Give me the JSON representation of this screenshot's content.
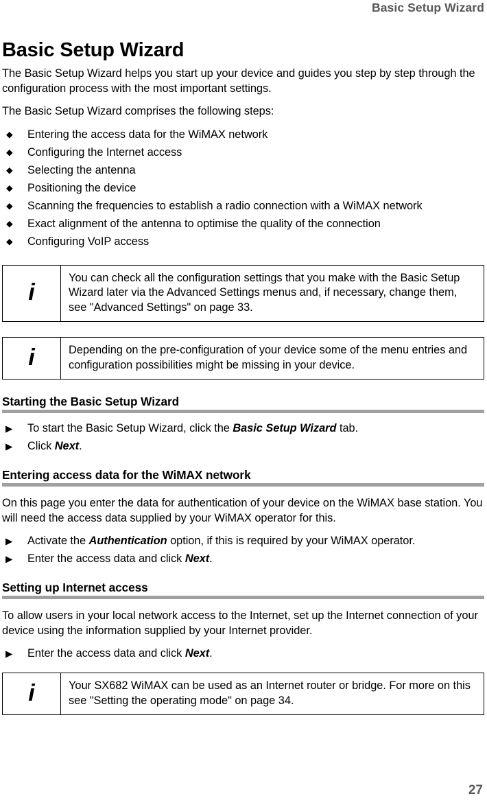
{
  "header": {
    "running_title": "Basic Setup Wizard"
  },
  "page": {
    "title": "Basic Setup Wizard",
    "number": "27"
  },
  "intro": {
    "paragraph_1": "The Basic Setup Wizard helps you start up your device and guides you step by step through the configuration process with the most important settings.",
    "paragraph_2": "The Basic Setup Wizard comprises the following steps:"
  },
  "steps": {
    "marker": "◆",
    "items": [
      "Entering the access data for the WiMAX network",
      "Configuring the Internet access",
      "Selecting the antenna",
      "Positioning the device",
      "Scanning the frequencies to establish a radio connection with a WiMAX network",
      "Exact alignment of the antenna to optimise the quality of the connection",
      "Configuring VoIP access"
    ]
  },
  "notes": {
    "icon": "i",
    "note_1": "You can check all the configuration settings that you make with the Basic Setup Wizard later via the Advanced Settings menus and, if necessary, change them, see \"Advanced Settings\" on page 33.",
    "note_2": "Depending on the pre-configuration of your device some of the menu entries and configuration possibilities might be missing in your device.",
    "note_3": "Your SX682 WiMAX can be used as an Internet router or bridge. For more on this see \"Setting the operating mode\" on page 34."
  },
  "sections": {
    "starting": {
      "heading": "Starting the Basic Setup Wizard",
      "action_marker": "▶",
      "action_1_pre": "To start the Basic Setup Wizard, click the ",
      "action_1_bold": "Basic Setup Wizard",
      "action_1_post": " tab.",
      "action_2_pre": "Click ",
      "action_2_bold": "Next",
      "action_2_post": "."
    },
    "entering_access_data": {
      "heading": "Entering access data for the WiMAX network",
      "paragraph": "On this page you enter the data for authentication of your device on the WiMAX base station. You will need the access data supplied by your WiMAX operator for this.",
      "action_marker": "▶",
      "action_1_pre": "Activate the ",
      "action_1_bold": "Authentication",
      "action_1_post": " option, if this is required by your WiMAX operator.",
      "action_2_pre": "Enter the access data and click ",
      "action_2_bold": "Next",
      "action_2_post": "."
    },
    "internet_access": {
      "heading": "Setting up Internet access",
      "paragraph": "To allow users in your local network access to the Internet, set up the Internet connection of your device using the information supplied by your Internet provider.",
      "action_marker": "▶",
      "action_1_pre": "Enter the access data and click ",
      "action_1_bold": "Next",
      "action_1_post": "."
    }
  },
  "colors": {
    "header_gray": "#58585a",
    "rule_gray": "#a0a0a0",
    "text_black": "#000000"
  }
}
